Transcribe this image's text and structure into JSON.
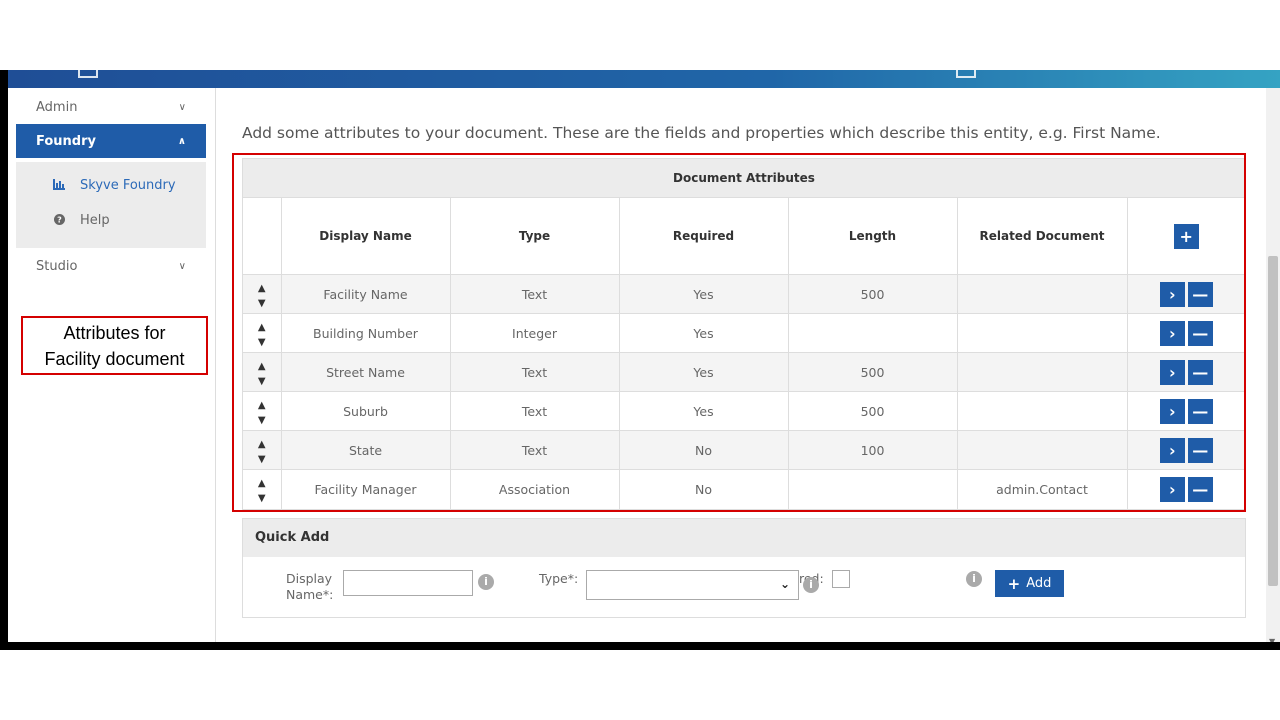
{
  "sidebar": {
    "items": [
      {
        "label": "Admin",
        "chevron": "chevron-down-icon"
      },
      {
        "label": "Foundry",
        "chevron": "chevron-up-icon"
      },
      {
        "label": "Studio",
        "chevron": "chevron-down-icon"
      }
    ],
    "sub_items": [
      {
        "label": "Skyve Foundry",
        "icon": "bar-chart-icon"
      },
      {
        "label": "Help",
        "icon": "question-circle-icon"
      }
    ]
  },
  "main": {
    "intro": "Add some attributes to your document. These are the fields and properties which describe this entity, e.g. First Name.",
    "attributes_panel": {
      "title": "Document Attributes",
      "columns": [
        "Display Name",
        "Type",
        "Required",
        "Length",
        "Related Document"
      ],
      "rows": [
        {
          "display_name": "Facility Name",
          "type": "Text",
          "required": "Yes",
          "length": "500",
          "related": ""
        },
        {
          "display_name": "Building Number",
          "type": "Integer",
          "required": "Yes",
          "length": "",
          "related": ""
        },
        {
          "display_name": "Street Name",
          "type": "Text",
          "required": "Yes",
          "length": "500",
          "related": ""
        },
        {
          "display_name": "Suburb",
          "type": "Text",
          "required": "Yes",
          "length": "500",
          "related": ""
        },
        {
          "display_name": "State",
          "type": "Text",
          "required": "No",
          "length": "100",
          "related": ""
        },
        {
          "display_name": "Facility Manager",
          "type": "Association",
          "required": "No",
          "length": "",
          "related": "admin.Contact"
        }
      ]
    },
    "quick_add": {
      "title": "Quick Add",
      "display_name_label_1": "Display",
      "display_name_label_2": "Name*:",
      "type_label": "Type*:",
      "required_label_fragment": "red:",
      "add_label": "Add"
    }
  },
  "callout": {
    "line1": "Attributes for",
    "line2": "Facility document"
  },
  "colors": {
    "brand_blue": "#1f5ca8",
    "highlight_red": "#d40000"
  }
}
